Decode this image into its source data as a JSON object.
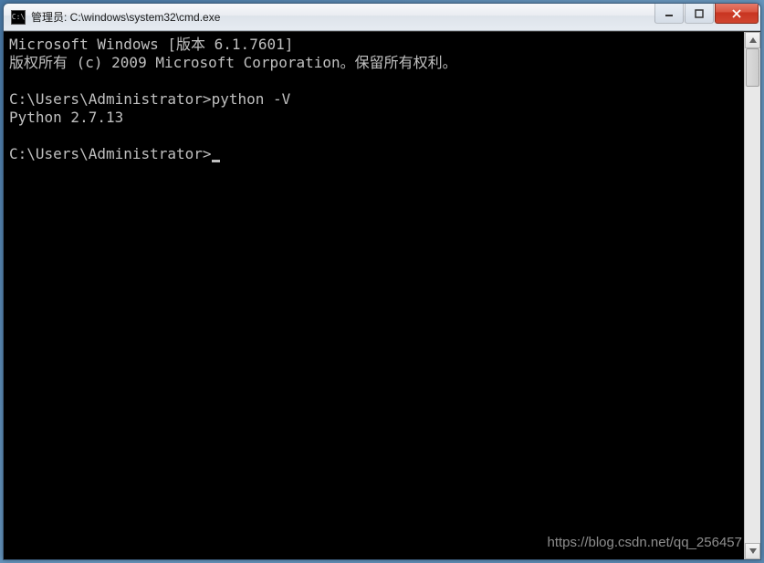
{
  "titlebar": {
    "icon_label": "C:\\",
    "title": "管理员: C:\\windows\\system32\\cmd.exe"
  },
  "terminal": {
    "line1": "Microsoft Windows [版本 6.1.7601]",
    "line2": "版权所有 (c) 2009 Microsoft Corporation。保留所有权利。",
    "prompt1": "C:\\Users\\Administrator>",
    "command1": "python -V",
    "output1": "Python 2.7.13",
    "prompt2": "C:\\Users\\Administrator>"
  },
  "watermark": "https://blog.csdn.net/qq_256457"
}
